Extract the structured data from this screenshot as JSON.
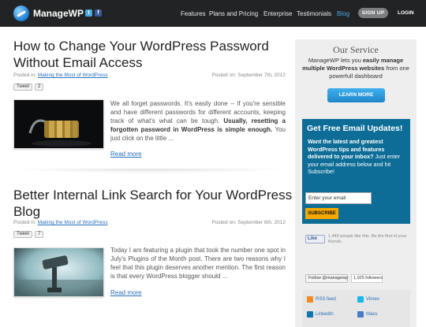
{
  "header": {
    "logo": "ManageWP",
    "social": {
      "twitter": "t",
      "facebook": "f"
    },
    "nav": [
      {
        "label": "Features",
        "active": false
      },
      {
        "label": "Plans and Pricing",
        "active": false
      },
      {
        "label": "Enterprise",
        "active": false
      },
      {
        "label": "Testimonials",
        "active": false
      },
      {
        "label": "Blog",
        "active": true
      }
    ],
    "signup": "SIGN UP",
    "login": "LOGIN"
  },
  "posts": [
    {
      "title": "How to Change Your WordPress Password Without Email Access",
      "posted_in_label": "Posted in:",
      "category": "Making the Most of WordPress",
      "date": "Posted on: September 7th, 2012",
      "tweet": "Tweet",
      "tweet_count": "2",
      "excerpt_start": "We all forget passwords. It's easily done -- if you're sensible and have different passwords for different accounts, keeping track of what's what can be tough. ",
      "excerpt_bold": "Usually, resetting a forgotten password in WordPress is simple enough.",
      "excerpt_end": " You just click on the little ...",
      "read_more": "Read more",
      "thumb_icon": "padlock-image"
    },
    {
      "title": "Better Internal Link Search for Your WordPress Blog",
      "posted_in_label": "Posted in:",
      "category": "Making the Most of WordPress",
      "date": "Posted on: September 6th, 2012",
      "tweet": "Tweet",
      "tweet_count": "7",
      "excerpt_start": "Today I am featuring a plugin that took the number one spot in July's Plugins of the Month post. There are two reasons why I feel that this plugin deserves another mention. The first reason is that every WordPress blogger should ...",
      "read_more": "Read more",
      "thumb_icon": "telescope-image"
    }
  ],
  "sidebar": {
    "service_title": "Our Service",
    "service_text_start": "ManageWP lets you ",
    "service_text_bold": "easily manage multiple WordPress websites",
    "service_text_end": " from one powerfull dashboard",
    "learn_more": "LEARN MORE",
    "email_heading": "Get Free Email Updates!",
    "email_text_bold": "Want the latest and greatest WordPress tips and features delivered to your inbox?",
    "email_text": " Just enter your email address below and hit Subscribe!",
    "email_placeholder": "Enter your email",
    "subscribe": "SUBSCRIBE",
    "fb_like": "Like",
    "fb_text": "1,440 people like this. Be the first of your friends.",
    "follow": "Follow @managewp",
    "followers": "1,925 followers",
    "links": [
      {
        "label": "RSS feed",
        "icon": "rss-icon",
        "color": "#f08a24"
      },
      {
        "label": "Vimeo",
        "icon": "vimeo-icon",
        "color": "#1ab7ea"
      },
      {
        "label": "LinkedIn",
        "icon": "linkedin-icon",
        "color": "#0e76a8"
      },
      {
        "label": "Mass",
        "icon": "mass-icon",
        "color": "#4a7cc7"
      }
    ]
  },
  "colors": {
    "header_bg": "#222324",
    "accent_blue": "#0d6d96",
    "link": "#2a6fba",
    "subscribe": "#f5a800"
  }
}
